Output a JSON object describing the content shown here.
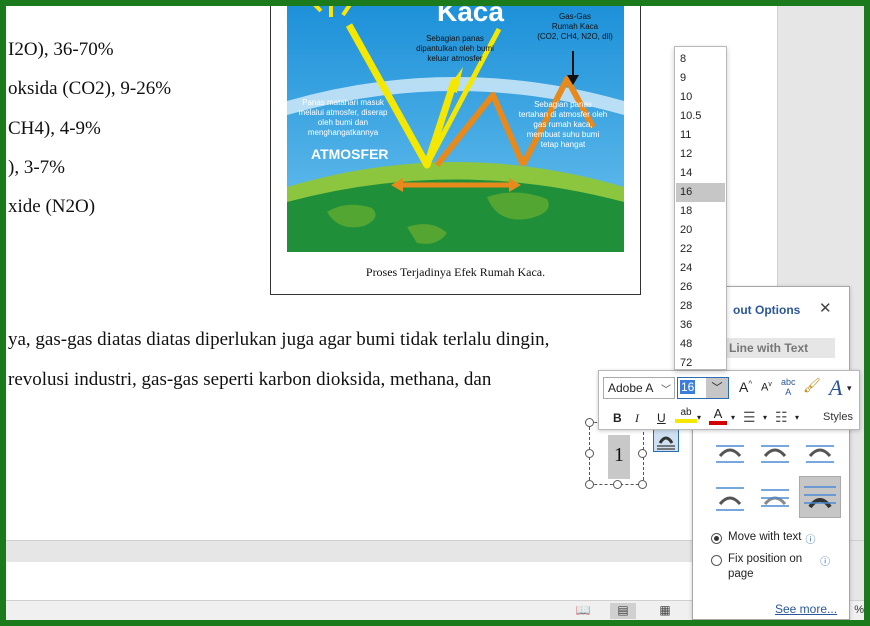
{
  "document": {
    "lines": [
      "I2O), 36-70%",
      "oksida (CO2), 9-26%",
      "CH4), 4-9%",
      "), 3-7%",
      "xide (N2O)"
    ],
    "paragraph_line1": "ya, gas-gas diatas diatas diperlukan juga agar bumi tidak terlalu dingin,",
    "paragraph_line2": "revolusi industri, gas-gas seperti karbon dioksida, methana, dan",
    "textbox_number": "1"
  },
  "figure": {
    "caption": "Proses Terjadinya Efek Rumah Kaca.",
    "title": "Kaca",
    "label_gas_title": "Gas-Gas",
    "label_gas_line2": "Rumah Kaca",
    "label_gas_line3": "(CO2, CH4, N2O, dll)",
    "label_reflect_1": "Sebagian panas",
    "label_reflect_2": "dipantulkan oleh bumi",
    "label_reflect_3": "keluar atmosfer",
    "label_sun_1": "Panas matahari masuk",
    "label_sun_2": "melalui atmosfer, diserap",
    "label_sun_3": "oleh bumi dan",
    "label_sun_4": "menghangatkannya",
    "label_trap_1": "Sebagian panas",
    "label_trap_2": "tertahan di atmosfer oleh",
    "label_trap_3": "gas rumah kaca,",
    "label_trap_4": "membuat suhu bumi",
    "label_trap_5": "tetap hangat",
    "atmosfer_label": "ATMOSFER"
  },
  "font_size_list": {
    "options": [
      "8",
      "9",
      "10",
      "10.5",
      "11",
      "12",
      "14",
      "16",
      "18",
      "20",
      "22",
      "24",
      "26",
      "28",
      "36",
      "48",
      "72"
    ],
    "selected": "16"
  },
  "mini_toolbar": {
    "font_name": "Adobe A",
    "font_size": "16",
    "grow_font": "A",
    "shrink_font": "A",
    "bold": "B",
    "italic": "I",
    "underline": "U",
    "styles_label": "Styles"
  },
  "layout_options": {
    "title": "out Options",
    "inline_label": "Line with Text",
    "move_with_text": "Move with text",
    "fix_position_line1": "Fix position on",
    "fix_position_line2": "page",
    "see_more": "See more...",
    "selected_wrap_index": 5
  },
  "status": {
    "zoom_suffix": "%"
  },
  "colors": {
    "frame_border": "#1b7a1b",
    "accent_blue": "#2b579a",
    "highlight_yellow": "#f5e800",
    "font_color_red": "#d40000"
  }
}
